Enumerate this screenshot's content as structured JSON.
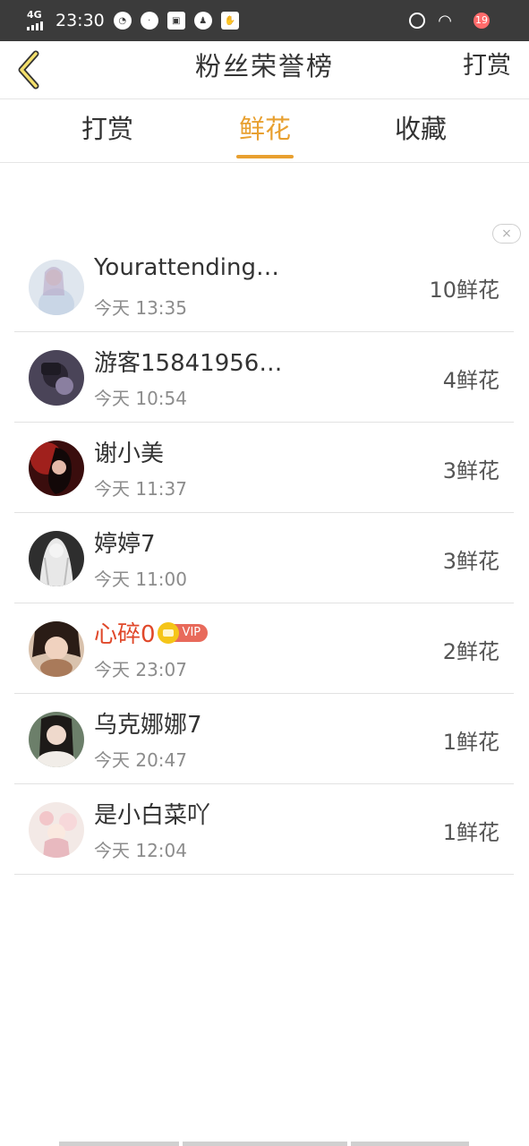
{
  "status_bar": {
    "network": "4G",
    "time": "23:30",
    "weather_temp": "19"
  },
  "header": {
    "title": "粉丝荣誉榜",
    "action_label": "打赏"
  },
  "tabs": [
    {
      "label": "打赏"
    },
    {
      "label": "鲜花"
    },
    {
      "label": "收藏"
    }
  ],
  "active_tab": "鲜花",
  "close_label": "×",
  "fans": [
    {
      "name": "Yourattending…",
      "time": "今天 13:35",
      "flowers": "10鲜花"
    },
    {
      "name": "游客15841956…",
      "time": "今天 10:54",
      "flowers": "4鲜花"
    },
    {
      "name": "谢小美",
      "time": "今天 11:37",
      "flowers": "3鲜花"
    },
    {
      "name": "婷婷7",
      "time": "今天 11:00",
      "flowers": "3鲜花"
    },
    {
      "name": "心碎0",
      "vip_label": "VIP",
      "time": "今天 23:07",
      "flowers": "2鲜花"
    },
    {
      "name": "乌克娜娜7",
      "time": "今天 20:47",
      "flowers": "1鲜花"
    },
    {
      "name": "是小白菜吖",
      "time": "今天 12:04",
      "flowers": "1鲜花"
    }
  ],
  "colors": {
    "accent": "#e8a030",
    "vip_name": "#e0482a",
    "status_bar": "#3b3b3b"
  }
}
